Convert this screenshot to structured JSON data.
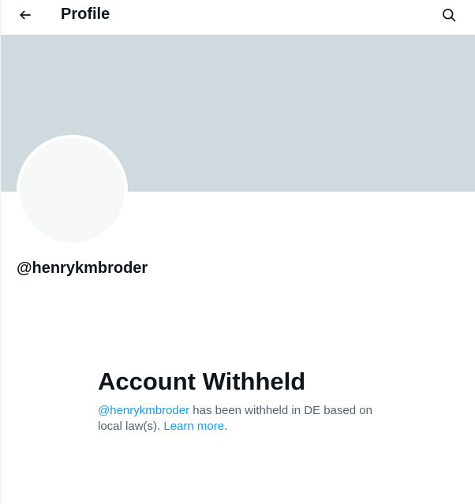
{
  "header": {
    "title": "Profile",
    "back_icon": "arrow-left-icon",
    "search_icon": "search-icon"
  },
  "profile": {
    "handle": "@henrykmbroder"
  },
  "withheld": {
    "title": "Account Withheld",
    "message_handle": "@henrykmbroder",
    "message_text": " has been withheld in DE based on local law(s). ",
    "learn_more_label": "Learn more",
    "message_end": "."
  },
  "colors": {
    "banner": "#cfd9de",
    "avatar": "#f7f9f9",
    "link": "#1d9bf0",
    "text_primary": "#0f1419",
    "text_secondary": "#536471"
  }
}
